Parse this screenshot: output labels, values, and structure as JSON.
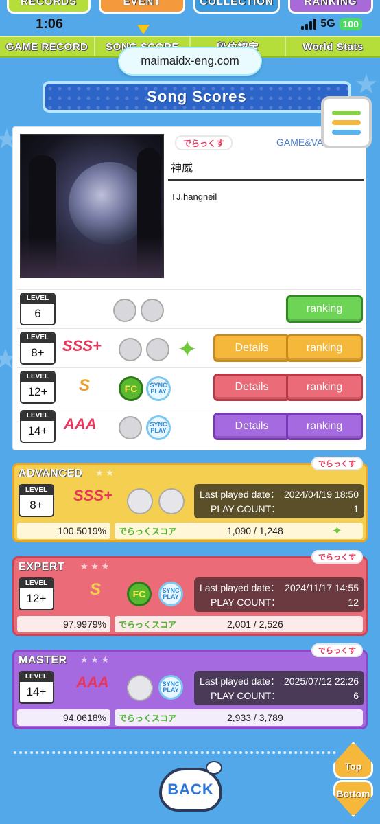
{
  "top_tabs": {
    "records": "RECORDS",
    "event": "EVENT",
    "collection": "COLLECTION",
    "ranking": "RANKING"
  },
  "status": {
    "time": "1:06",
    "network": "5G",
    "battery": "100"
  },
  "nav": {
    "game_record": "GAME RECORD",
    "song_score": "SONG SCORE",
    "dan": "段位認定",
    "world_stats": "World Stats"
  },
  "url": "maimaidx-eng.com",
  "banner_title": "Song Scores",
  "song": {
    "type_badge": "でらっくす",
    "genre": "GAME&VARIETY",
    "title": "神威",
    "artist": "TJ.hangneil"
  },
  "level_rows": [
    {
      "level_label": "LEVEL",
      "level": "6",
      "ranking": "ranking"
    },
    {
      "level_label": "LEVEL",
      "level": "8+",
      "rank": "SSS+",
      "details": "Details",
      "ranking": "ranking"
    },
    {
      "level_label": "LEVEL",
      "level": "12+",
      "rank": "S",
      "fc": "FC",
      "sync": "SYNC PLAY",
      "details": "Details",
      "ranking": "ranking"
    },
    {
      "level_label": "LEVEL",
      "level": "14+",
      "rank": "AAA",
      "sync": "SYNC PLAY",
      "details": "Details",
      "ranking": "ranking"
    }
  ],
  "panels": {
    "advanced": {
      "label": "ADVANCED",
      "tag": "でらっくす",
      "level_label": "LEVEL",
      "level": "8+",
      "rank": "SSS+",
      "last_played_label": "Last played date：",
      "last_played": "2024/04/19 18:50",
      "play_count_label": "PLAY COUNT：",
      "play_count": "1",
      "achievement": "100.5019%",
      "dxscore_label": "でらっくスコア",
      "dxscore": "1,090 / 1,248"
    },
    "expert": {
      "label": "EXPERT",
      "tag": "でらっくす",
      "level_label": "LEVEL",
      "level": "12+",
      "rank": "S",
      "fc": "FC",
      "sync": "SYNC PLAY",
      "last_played_label": "Last played date：",
      "last_played": "2024/11/17 14:55",
      "play_count_label": "PLAY COUNT：",
      "play_count": "12",
      "achievement": "97.9979%",
      "dxscore_label": "でらっくスコア",
      "dxscore": "2,001 / 2,526"
    },
    "master": {
      "label": "MASTER",
      "tag": "でらっくす",
      "level_label": "LEVEL",
      "level": "14+",
      "rank": "AAA",
      "sync": "SYNC PLAY",
      "last_played_label": "Last played date：",
      "last_played": "2025/07/12 22:26",
      "play_count_label": "PLAY COUNT：",
      "play_count": "6",
      "achievement": "94.0618%",
      "dxscore_label": "でらっくスコア",
      "dxscore": "2,933 / 3,789"
    }
  },
  "bottom": {
    "back": "BACK",
    "top": "Top",
    "bottom": "Bottom"
  },
  "colors": {
    "background": "#52a8e8",
    "advanced": "#f5d050",
    "expert": "#ec6b78",
    "master": "#a66ae0",
    "nav": "#b5de3a"
  }
}
